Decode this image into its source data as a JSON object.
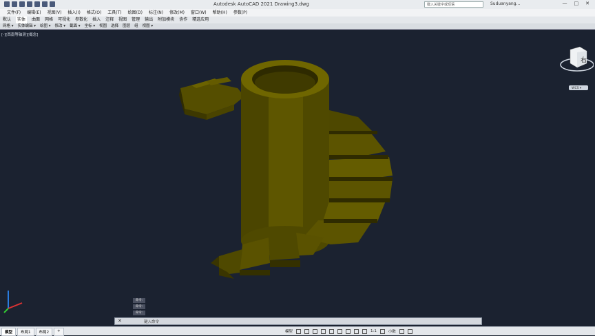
{
  "app": {
    "title": "Autodesk AutoCAD 2021    Drawing3.dwg",
    "search_placeholder": "键入关键字或短语",
    "user": "Suduanyang...",
    "window_controls": [
      "—",
      "□",
      "✕"
    ]
  },
  "menu": [
    "文件(F)",
    "编辑(E)",
    "视图(V)",
    "插入(I)",
    "格式(O)",
    "工具(T)",
    "绘图(D)",
    "标注(N)",
    "修改(M)",
    "窗口(W)",
    "帮助(H)",
    "参数(P)"
  ],
  "ribbon_tabs": [
    {
      "label": "默认",
      "active": false
    },
    {
      "label": "实体",
      "active": true
    },
    {
      "label": "曲面",
      "active": false
    },
    {
      "label": "网格",
      "active": false
    },
    {
      "label": "可视化",
      "active": false
    },
    {
      "label": "参数化",
      "active": false
    },
    {
      "label": "插入",
      "active": false
    },
    {
      "label": "注释",
      "active": false
    },
    {
      "label": "视图",
      "active": false
    },
    {
      "label": "管理",
      "active": false
    },
    {
      "label": "输出",
      "active": false
    },
    {
      "label": "附加模块",
      "active": false
    },
    {
      "label": "协作",
      "active": false
    },
    {
      "label": "精选应用",
      "active": false
    }
  ],
  "panels": [
    "网格 ▾",
    "实体编辑 ▾",
    "绘图 ▾",
    "修改 ▾",
    "截面 ▾",
    "坐标 ▾",
    "视图",
    "选择",
    "图层",
    "组",
    "视图 ▾"
  ],
  "viewport_label": "[-][西南等轴测][概念]",
  "viewcube": {
    "face": "右",
    "wcs_label": "WCS ▾"
  },
  "command": {
    "history": [
      "命令:",
      "命令:",
      "命令:"
    ],
    "prompt": "键入命令"
  },
  "status": {
    "layout_tabs": [
      {
        "label": "模型",
        "active": true
      },
      {
        "label": "布局1",
        "active": false
      },
      {
        "label": "布局2",
        "active": false
      },
      {
        "label": "+",
        "active": false
      }
    ],
    "model_label": "模型",
    "scale": "1:1",
    "units": "小数"
  },
  "colors": {
    "background": "#1b2230",
    "object": "#6b6200"
  }
}
